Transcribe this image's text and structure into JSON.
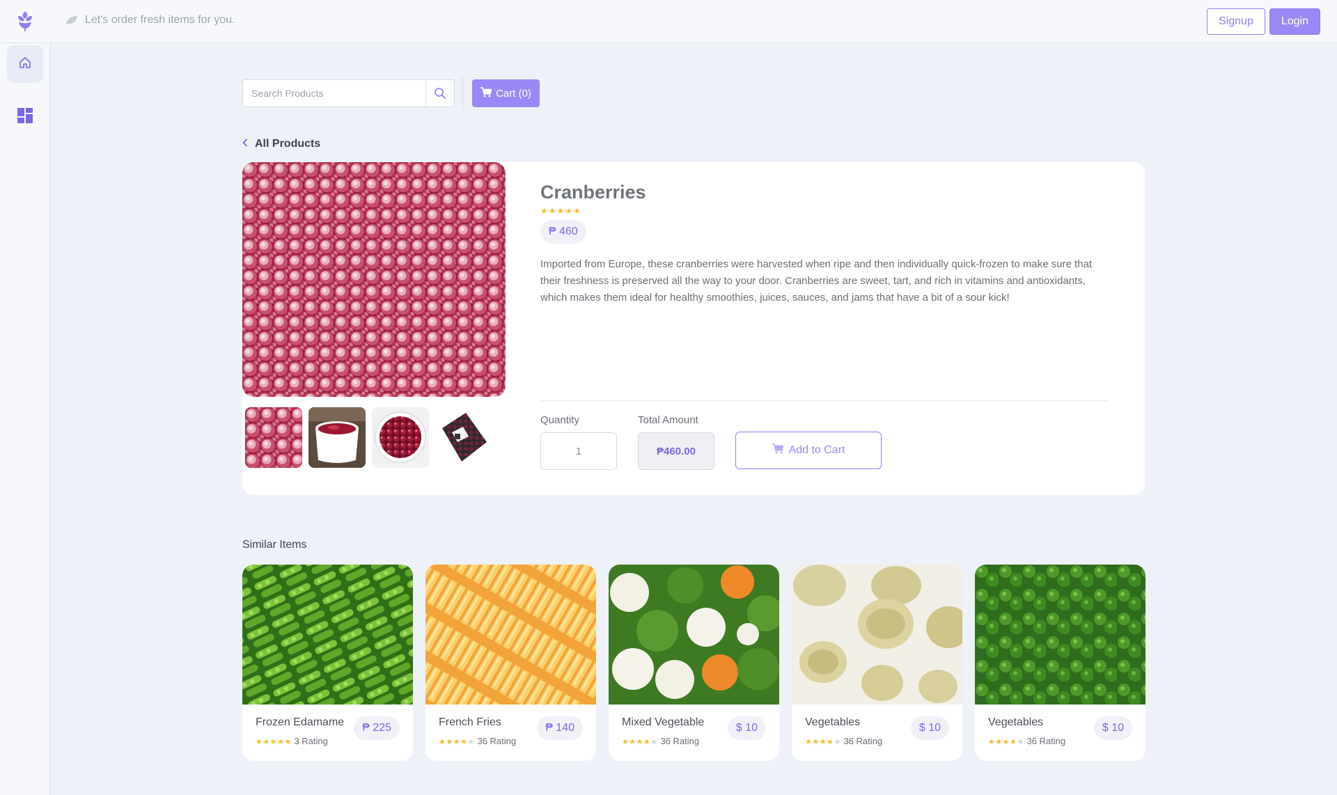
{
  "header": {
    "tagline": "Let's order fresh items for you.",
    "signup_label": "Signup",
    "login_label": "Login"
  },
  "search": {
    "placeholder": "Search Products",
    "cart_label": "Cart (0)"
  },
  "breadcrumb": {
    "back_label": "All Products"
  },
  "product": {
    "name": "Cranberries",
    "rating": 5,
    "price": "₱ 460",
    "description": "Imported from Europe, these cranberries were harvested when ripe and then individually quick-frozen to make sure that their freshness is preserved all the way to your door. Cranberries are sweet, tart, and rich in vitamins and antioxidants, which makes them ideal for healthy smoothies, juices, sauces, and jams that have a bit of a sour kick!",
    "quantity_label": "Quantity",
    "quantity_value": "1",
    "total_label": "Total Amount",
    "total_value": "₱460.00",
    "add_to_cart_label": "Add to Cart",
    "colors": {
      "accent": "#9a88f7",
      "star": "#f7b924"
    }
  },
  "similar": {
    "title": "Similar Items",
    "items": [
      {
        "name": "Frozen Edamame",
        "rating": 5,
        "rating_text": "3 Rating",
        "price": "₱ 225"
      },
      {
        "name": "French Fries",
        "rating": 4,
        "rating_text": "36 Rating",
        "price": "₱ 140"
      },
      {
        "name": "Mixed Vegetable",
        "rating": 4,
        "rating_text": "36 Rating",
        "price": "$ 10"
      },
      {
        "name": "Vegetables",
        "rating": 4,
        "rating_text": "36 Rating",
        "price": "$ 10"
      },
      {
        "name": "Vegetables",
        "rating": 4,
        "rating_text": "36 Rating",
        "price": "$ 10"
      }
    ]
  }
}
